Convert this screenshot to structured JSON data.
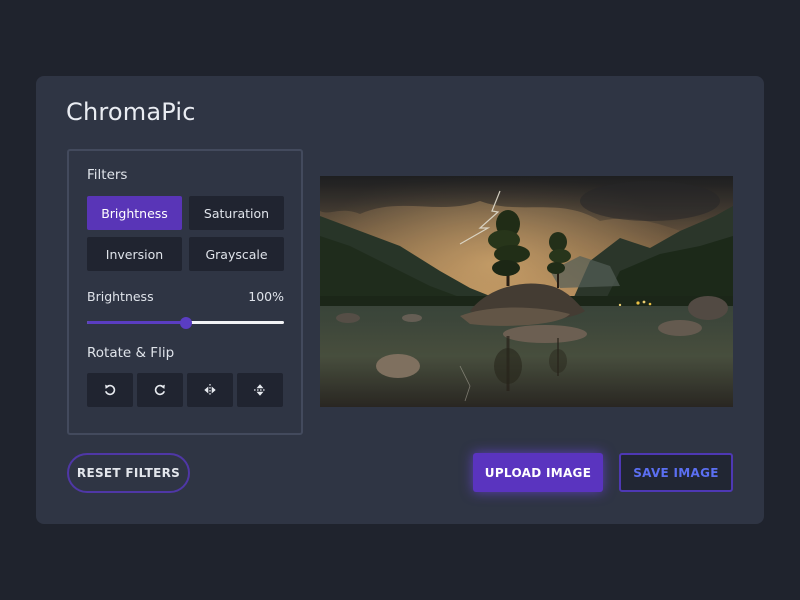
{
  "app": {
    "title": "ChromaPic"
  },
  "filters": {
    "heading": "Filters",
    "buttons": [
      {
        "label": "Brightness",
        "active": true
      },
      {
        "label": "Saturation",
        "active": false
      },
      {
        "label": "Inversion",
        "active": false
      },
      {
        "label": "Grayscale",
        "active": false
      }
    ]
  },
  "slider": {
    "name": "Brightness",
    "value_text": "100%",
    "level": 0.5
  },
  "rotate": {
    "heading": "Rotate & Flip",
    "buttons": [
      "rotate-left-icon",
      "rotate-right-icon",
      "flip-horizontal-icon",
      "flip-vertical-icon"
    ]
  },
  "actions": {
    "reset": "RESET FILTERS",
    "upload": "UPLOAD IMAGE",
    "save": "SAVE IMAGE"
  },
  "colors": {
    "background": "#1f232d",
    "card": "#2f3544",
    "accent": "#5a34bf",
    "save_text": "#5b6ff2"
  }
}
